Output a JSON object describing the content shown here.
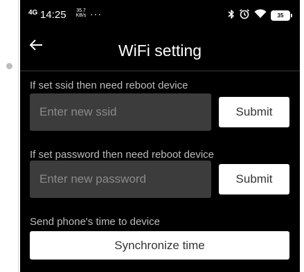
{
  "status_bar": {
    "network": "4G",
    "time": "14:25",
    "speed_value": "35.7",
    "speed_unit": "KB/s",
    "more": "···",
    "bluetooth_icon": "bluetooth-icon",
    "alarm_icon": "alarm-icon",
    "wifi_icon": "wifi-icon",
    "battery": "35"
  },
  "appbar": {
    "back_icon": "arrow-left-icon",
    "title": "WiFi setting"
  },
  "ssid": {
    "label": "If set ssid then need reboot device",
    "placeholder": "Enter new ssid",
    "submit": "Submit"
  },
  "password": {
    "label": "If set password then need reboot device",
    "placeholder": "Enter new password",
    "submit": "Submit"
  },
  "time_sync": {
    "label": "Send phone's time to device",
    "button": "Synchronize time"
  },
  "colors": {
    "background": "#000000",
    "input_bg": "#3c3c3c",
    "button_bg": "#ffffff",
    "label": "#bdbdbd",
    "placeholder": "#8a8a8a"
  }
}
